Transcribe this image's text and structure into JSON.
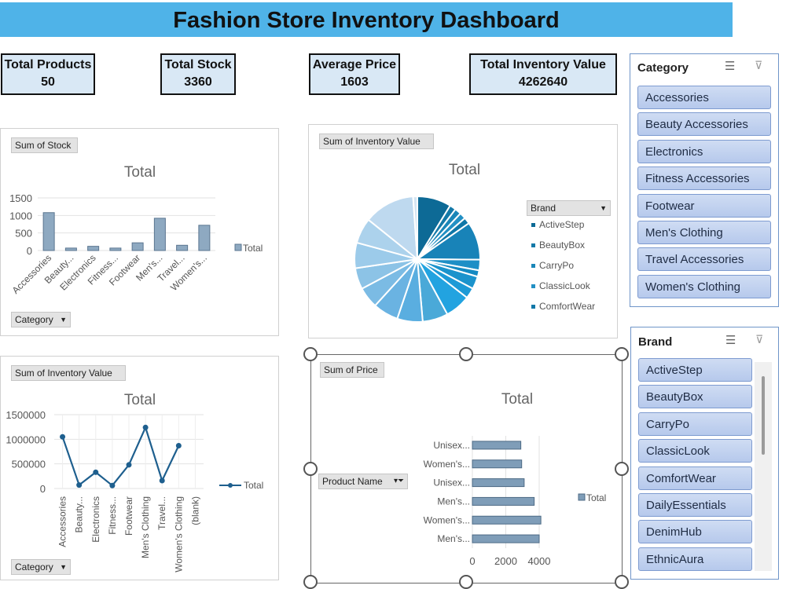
{
  "dashboard": {
    "title": "Fashion Store Inventory Dashboard"
  },
  "kpis": [
    {
      "label": "Total Products",
      "value": "50"
    },
    {
      "label": "Total Stock",
      "value": "3360"
    },
    {
      "label": "Average Price",
      "value": "1603"
    },
    {
      "label": "Total Inventory Value",
      "value": "4262640"
    }
  ],
  "charts": {
    "stock": {
      "field_button": "Sum of Stock",
      "axis_button": "Category",
      "axis_button_icon": "dropdown-arrow-icon"
    },
    "pie": {
      "field_button": "Sum of Inventory Value",
      "legend_button": "Brand",
      "legend_button_icon": "dropdown-arrow-icon"
    },
    "line": {
      "field_button": "Sum of Inventory Value",
      "axis_button": "Category",
      "axis_button_icon": "dropdown-arrow-icon"
    },
    "price": {
      "field_button": "Sum of Price",
      "axis_button": "Product Name",
      "axis_button_icon": "filter-icon"
    }
  },
  "chart_data": [
    {
      "type": "bar",
      "title": "Total",
      "categories": [
        "Accessories",
        "Beauty...",
        "Electronics",
        "Fitness...",
        "Footwear",
        "Men's...",
        "Travel...",
        "Women's..."
      ],
      "series": [
        {
          "name": "Total",
          "values": [
            1080,
            70,
            120,
            70,
            220,
            920,
            150,
            720
          ]
        }
      ],
      "ylim": [
        0,
        1500
      ],
      "yticks": [
        0,
        500,
        1000,
        1500
      ],
      "grid": true,
      "legend": "right",
      "color": "#8ea9c1"
    },
    {
      "type": "pie",
      "title": "Total",
      "legend_title": "Brand",
      "legend_entries": [
        "ActiveStep",
        "BeautyBox",
        "CarryPo",
        "ClassicLook",
        "ComfortWear"
      ],
      "values": [
        8,
        1.5,
        1.5,
        1.5,
        1.5,
        9,
        2.5,
        1.5,
        3,
        2.5,
        6,
        6,
        6,
        6,
        5,
        5,
        6,
        6,
        12,
        1
      ],
      "colors": [
        "#0d6a96",
        "#1479a8",
        "#1a86b8",
        "#2290c4",
        "#0f77a8",
        "#1883b8",
        "#1e8fc6",
        "#148ac2",
        "#1b93cc",
        "#1d9ad6",
        "#22a3e0",
        "#4aa9d8",
        "#5aaee0",
        "#6ab3e2",
        "#7bbbe4",
        "#8cc3e6",
        "#9ccbea",
        "#acd2ec",
        "#bed9ef",
        "#d4e5f3"
      ],
      "legend": "right"
    },
    {
      "type": "line",
      "title": "Total",
      "categories": [
        "Accessories",
        "Beauty...",
        "Electronics",
        "Fitness...",
        "Footwear",
        "Men's Clothing",
        "Travel...",
        "Women's Clothing",
        "(blank)"
      ],
      "series": [
        {
          "name": "Total",
          "values": [
            1050000,
            70000,
            330000,
            60000,
            480000,
            1240000,
            160000,
            870000,
            null
          ]
        }
      ],
      "ylim": [
        0,
        1500000
      ],
      "yticks": [
        0,
        500000,
        1000000,
        1500000
      ],
      "grid": true,
      "legend": "right",
      "color": "#1e5f8e"
    },
    {
      "type": "bar",
      "orientation": "horizontal",
      "title": "Total",
      "categories": [
        "Unisex...",
        "Women's...",
        "Unisex...",
        "Men's...",
        "Women's...",
        "Men's..."
      ],
      "series": [
        {
          "name": "Total",
          "values": [
            2900,
            2950,
            3100,
            3700,
            4100,
            4000
          ]
        }
      ],
      "xlim": [
        0,
        4000
      ],
      "xticks": [
        0,
        2000,
        4000
      ],
      "grid": true,
      "legend": "right",
      "color": "#7f9db8"
    }
  ],
  "slicers": {
    "category": {
      "title": "Category",
      "multi_select_icon": "multi-select-icon",
      "clear_filter_icon": "clear-filter-icon",
      "items": [
        "Accessories",
        "Beauty Accessories",
        "Electronics",
        "Fitness Accessories",
        "Footwear",
        "Men's Clothing",
        "Travel Accessories",
        "Women's Clothing"
      ]
    },
    "brand": {
      "title": "Brand",
      "multi_select_icon": "multi-select-icon",
      "clear_filter_icon": "clear-filter-icon",
      "items": [
        "ActiveStep",
        "BeautyBox",
        "CarryPo",
        "ClassicLook",
        "ComfortWear",
        "DailyEssentials",
        "DenimHub",
        "EthnicAura"
      ]
    }
  },
  "colors": {
    "title_bar": "#4fb3e8",
    "kpi_fill": "#d9e8f5",
    "slicer_item": "#b6c9ec"
  }
}
